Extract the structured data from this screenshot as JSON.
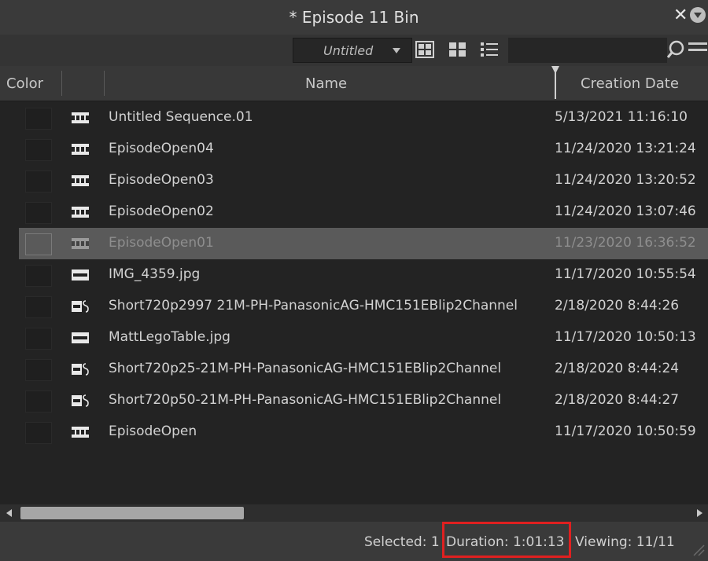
{
  "window": {
    "title": "* Episode 11 Bin"
  },
  "toolbar": {
    "view_name": "Untitled",
    "view_buttons": [
      "frame-view-icon",
      "script-view-icon",
      "list-view-icon"
    ],
    "search_placeholder": ""
  },
  "columns": {
    "color": "Color",
    "name": "Name",
    "creation_date": "Creation Date"
  },
  "rows": [
    {
      "name": "Untitled Sequence.01",
      "date": "5/13/2021 11:16:10",
      "icon": "sequence-icon",
      "selected": false
    },
    {
      "name": "EpisodeOpen04",
      "date": "11/24/2020 13:21:24",
      "icon": "sequence-icon",
      "selected": false
    },
    {
      "name": "EpisodeOpen03",
      "date": "11/24/2020 13:20:52",
      "icon": "sequence-icon",
      "selected": false
    },
    {
      "name": "EpisodeOpen02",
      "date": "11/24/2020 13:07:46",
      "icon": "sequence-icon",
      "selected": false
    },
    {
      "name": "EpisodeOpen01",
      "date": "11/23/2020 16:36:52",
      "icon": "sequence-icon",
      "selected": true
    },
    {
      "name": "IMG_4359.jpg",
      "date": "11/17/2020 10:55:54",
      "icon": "masterclip-icon",
      "selected": false
    },
    {
      "name": "Short720p2997 21M-PH-PanasonicAG-HMC151EBlip2Channel",
      "date": "2/18/2020 8:44:26",
      "icon": "linked-clip-icon",
      "selected": false
    },
    {
      "name": "MattLegoTable.jpg",
      "date": "11/17/2020 10:50:13",
      "icon": "masterclip-icon",
      "selected": false
    },
    {
      "name": "Short720p25-21M-PH-PanasonicAG-HMC151EBlip2Channel",
      "date": "2/18/2020 8:44:24",
      "icon": "linked-clip-icon",
      "selected": false
    },
    {
      "name": "Short720p50-21M-PH-PanasonicAG-HMC151EBlip2Channel",
      "date": "2/18/2020 8:44:27",
      "icon": "linked-clip-icon",
      "selected": false
    },
    {
      "name": "EpisodeOpen",
      "date": "11/17/2020 10:50:59",
      "icon": "sequence-icon",
      "selected": false
    }
  ],
  "status": {
    "selected": "Selected: 1",
    "duration": "Duration: 1:01:13",
    "viewing": "Viewing: 11/11"
  },
  "colors": {
    "background": "#232323",
    "selected_row": "#5a5a5a",
    "highlight_box": "#e02020"
  }
}
